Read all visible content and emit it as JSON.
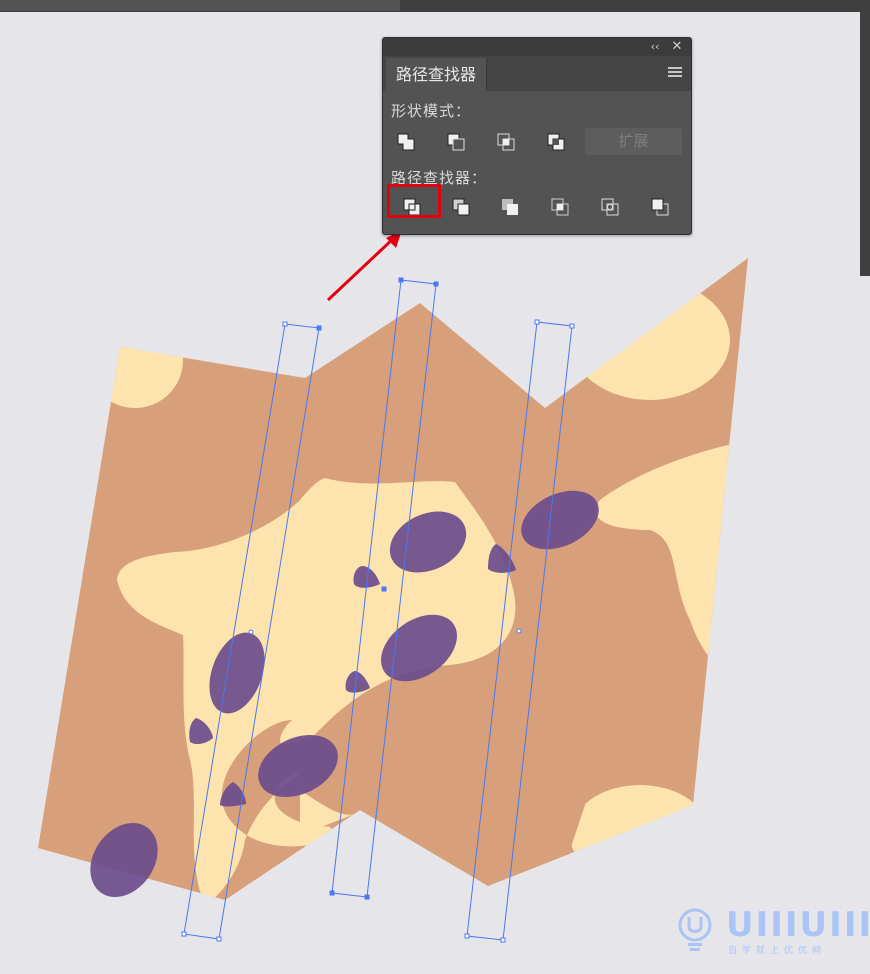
{
  "panel": {
    "collapse_glyph": "‹‹",
    "close_glyph": "✕",
    "tab_label": "路径查找器",
    "shape_modes_label": "形状模式：",
    "expand_label": "扩展",
    "pathfinders_label": "路径查找器：",
    "shape_mode_buttons": [
      "unite-icon",
      "minus-front-icon",
      "intersect-icon",
      "exclude-icon"
    ],
    "pathfinder_buttons": [
      "divide-icon",
      "trim-icon",
      "merge-icon",
      "crop-icon",
      "outline-icon",
      "minus-back-icon"
    ],
    "highlighted_button": "divide-icon"
  },
  "watermark": {
    "text": "UIIIUIII",
    "subtext": "自学就上优优网"
  },
  "colors": {
    "canvas": "#e6e6ea",
    "map_brown": "#d7a07b",
    "map_cream": "#fde4ae",
    "blob_purple": "#6b4c8c",
    "selection_blue": "#4a78f0",
    "highlight_red": "#e3000f",
    "panel_bg": "#535353"
  }
}
